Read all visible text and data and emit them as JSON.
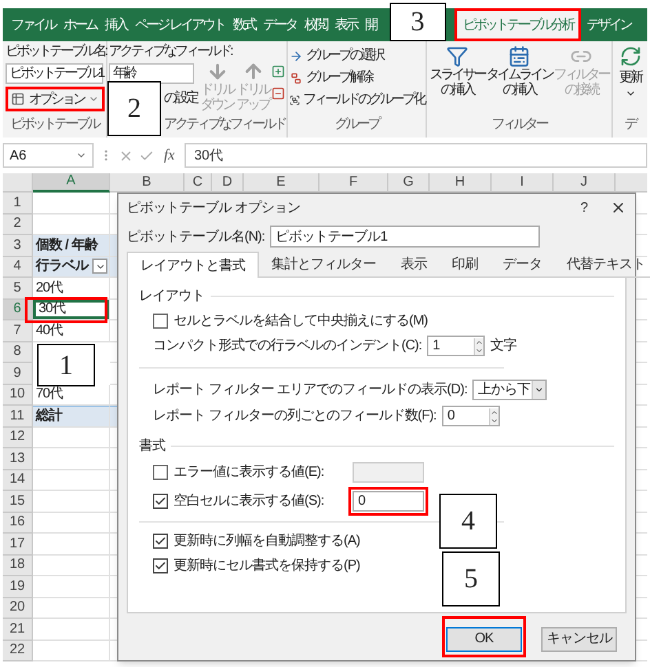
{
  "ribbon_tabs": [
    {
      "label": "ファイル",
      "selected": false,
      "highlighted": false
    },
    {
      "label": "ホーム",
      "selected": false,
      "highlighted": false
    },
    {
      "label": "挿入",
      "selected": false,
      "highlighted": false
    },
    {
      "label": "ページ レイアウト",
      "selected": false,
      "highlighted": false
    },
    {
      "label": "数式",
      "selected": false,
      "highlighted": false
    },
    {
      "label": "データ",
      "selected": false,
      "highlighted": false
    },
    {
      "label": "校閲",
      "selected": false,
      "highlighted": false
    },
    {
      "label": "表示",
      "selected": false,
      "highlighted": false
    },
    {
      "label": "開",
      "selected": false,
      "highlighted": false
    },
    {
      "label": "ピボットテーブル分析",
      "selected": true,
      "highlighted": true
    },
    {
      "label": "デザイン",
      "selected": false,
      "highlighted": false
    }
  ],
  "ribbon": {
    "pivot_table": {
      "name_label": "ピボットテーブル名:",
      "name_value": "ピボットテーブル1",
      "options_button": {
        "label": "オプション",
        "highlighted": true
      },
      "group_label": "ピボットテーブル"
    },
    "active_field": {
      "label": "アクティブなフィールド:",
      "value": "年齢",
      "settings_button": "の設定",
      "drill_down": {
        "label": "ドリルダウン",
        "disabled": true
      },
      "drill_up": {
        "label": "ドリルアップ",
        "disabled": true
      },
      "group_label": "アクティブなフィールド"
    },
    "group": {
      "items": [
        {
          "label": "グループの選択",
          "kind": "select"
        },
        {
          "label": "グループ解除",
          "kind": "ungroup"
        },
        {
          "label": "フィールドのグループ化",
          "kind": "group"
        }
      ],
      "group_label": "グループ"
    },
    "filter": {
      "items": [
        {
          "label": "スライサーの挿入",
          "kind": "slicer",
          "disabled": false
        },
        {
          "label": "タイムラインの挿入",
          "kind": "timeline",
          "disabled": false
        },
        {
          "label": "フィルターの接続",
          "kind": "connection",
          "disabled": true
        }
      ],
      "group_label": "フィルター"
    },
    "data": {
      "refresh": "更新",
      "group_label": "デ"
    }
  },
  "formula_bar": {
    "name_box": "A6",
    "function_label": "fx",
    "formula": "30代"
  },
  "sheet": {
    "columns": [
      {
        "label": "A",
        "selected": true
      },
      {
        "label": "B",
        "selected": false
      },
      {
        "label": "C",
        "selected": false
      },
      {
        "label": "D",
        "selected": false
      },
      {
        "label": "E",
        "selected": false
      },
      {
        "label": "F",
        "selected": false
      },
      {
        "label": "G",
        "selected": false
      },
      {
        "label": "H",
        "selected": false
      },
      {
        "label": "I",
        "selected": false
      },
      {
        "label": "J",
        "selected": false
      }
    ],
    "rows": [
      {
        "number": "1",
        "kind": "plain",
        "selected": false,
        "highlighted": false
      },
      {
        "number": "2",
        "kind": "plain",
        "selected": false,
        "highlighted": false
      },
      {
        "number": "3",
        "kind": "title",
        "label": "個数 / 年齢",
        "selected": false,
        "highlighted": false
      },
      {
        "number": "4",
        "kind": "label_header",
        "label": "行ラベル",
        "selected": false,
        "highlighted": false
      },
      {
        "number": "5",
        "kind": "plain",
        "label": "20代",
        "selected": false,
        "highlighted": false
      },
      {
        "number": "6",
        "kind": "plain",
        "label": "30代",
        "selected": true,
        "highlighted": true
      },
      {
        "number": "7",
        "kind": "plain",
        "label": "40代",
        "selected": false,
        "highlighted": false
      },
      {
        "number": "8",
        "kind": "plain",
        "selected": false,
        "highlighted": false
      },
      {
        "number": "9",
        "kind": "plain",
        "selected": false,
        "highlighted": false
      },
      {
        "number": "10",
        "kind": "plain",
        "label": "70代",
        "selected": false,
        "highlighted": false
      },
      {
        "number": "11",
        "kind": "total",
        "label": "総計",
        "selected": false,
        "highlighted": false
      },
      {
        "number": "12",
        "kind": "plain",
        "selected": false,
        "highlighted": false
      },
      {
        "number": "13",
        "kind": "plain",
        "selected": false,
        "highlighted": false
      },
      {
        "number": "14",
        "kind": "plain",
        "selected": false,
        "highlighted": false
      },
      {
        "number": "15",
        "kind": "plain",
        "selected": false,
        "highlighted": false
      },
      {
        "number": "16",
        "kind": "plain",
        "selected": false,
        "highlighted": false
      },
      {
        "number": "17",
        "kind": "plain",
        "selected": false,
        "highlighted": false
      },
      {
        "number": "18",
        "kind": "plain",
        "selected": false,
        "highlighted": false
      },
      {
        "number": "19",
        "kind": "plain",
        "selected": false,
        "highlighted": false
      },
      {
        "number": "20",
        "kind": "plain",
        "selected": false,
        "highlighted": false
      },
      {
        "number": "21",
        "kind": "plain",
        "selected": false,
        "highlighted": false
      },
      {
        "number": "22",
        "kind": "plain",
        "selected": false,
        "highlighted": false
      }
    ]
  },
  "dialog": {
    "title": "ピボットテーブル オプション",
    "help": "?",
    "name_label": "ピボットテーブル名(N):",
    "name_value": "ピボットテーブル1",
    "tabs": [
      {
        "label": "レイアウトと書式",
        "selected": true
      },
      {
        "label": "集計とフィルター",
        "selected": false
      },
      {
        "label": "表示",
        "selected": false
      },
      {
        "label": "印刷",
        "selected": false
      },
      {
        "label": "データ",
        "selected": false
      },
      {
        "label": "代替テキスト",
        "selected": false
      }
    ],
    "layout_heading": "レイアウト",
    "merge_cells": {
      "label": "セルとラベルを結合して中央揃えにする(M)",
      "checked": false
    },
    "indent": {
      "label": "コンパクト形式での行ラベルのインデント(C):",
      "value": "1",
      "unit": "文字"
    },
    "filter_order": {
      "label": "レポート フィルター エリアでのフィールドの表示(D):",
      "value": "上から下"
    },
    "filter_fields": {
      "label": "レポート フィルターの列ごとのフィールド数(F):",
      "value": "0"
    },
    "format_heading": "書式",
    "error_values": {
      "label": "エラー値に表示する値(E):",
      "checked": false,
      "disabled": true
    },
    "empty_cells": {
      "label": "空白セルに表示する値(S):",
      "checked": true,
      "value": "0",
      "highlighted": true
    },
    "options": [
      {
        "label": "更新時に列幅を自動調整する(A)",
        "checked": true
      },
      {
        "label": "更新時にセル書式を保持する(P)",
        "checked": true
      }
    ],
    "buttons": [
      {
        "label": "OK",
        "kind": "primary",
        "highlighted": true
      },
      {
        "label": "キャンセル",
        "kind": "secondary",
        "highlighted": false
      }
    ]
  },
  "callouts": [
    {
      "number": "1"
    },
    {
      "number": "2"
    },
    {
      "number": "3"
    },
    {
      "number": "4"
    },
    {
      "number": "5"
    }
  ]
}
